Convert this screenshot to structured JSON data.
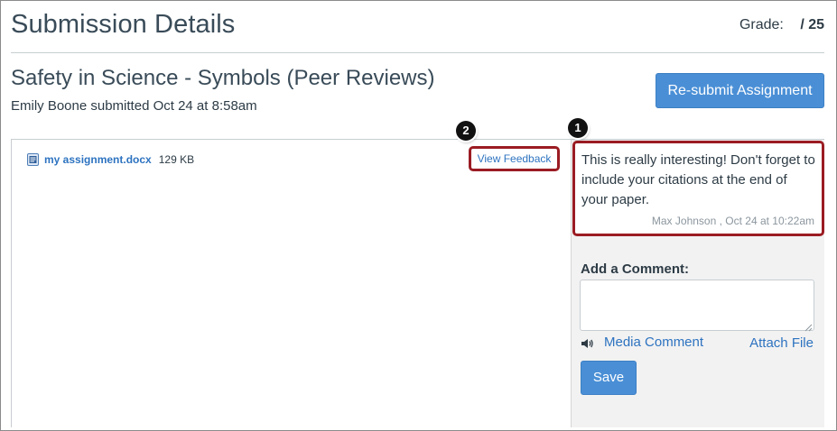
{
  "header": {
    "title": "Submission Details",
    "grade_label": "Grade:",
    "grade_total": "/ 25"
  },
  "assignment": {
    "title": "Safety in Science - Symbols (Peer Reviews)",
    "submitted_line": "Emily Boone submitted Oct 24 at 8:58am",
    "resubmit_label": "Re-submit Assignment"
  },
  "file": {
    "icon": "document-icon",
    "name": "my assignment.docx",
    "size": "129 KB",
    "view_feedback_label": "View Feedback"
  },
  "callouts": {
    "one": "1",
    "two": "2"
  },
  "comment": {
    "text": "This is really interesting! Don't forget to include your citations at the end of your paper.",
    "meta": "Max Johnson , Oct 24 at 10:22am"
  },
  "comment_form": {
    "label": "Add a Comment:",
    "textarea_value": "",
    "media_comment_label": "Media Comment",
    "media_icon": "speaker-icon",
    "attach_file_label": "Attach File",
    "save_label": "Save"
  },
  "colors": {
    "accent": "#4a8fd6",
    "link": "#2d73c0",
    "highlight": "#9b1c23",
    "sidebar": "#f2f2f2"
  }
}
